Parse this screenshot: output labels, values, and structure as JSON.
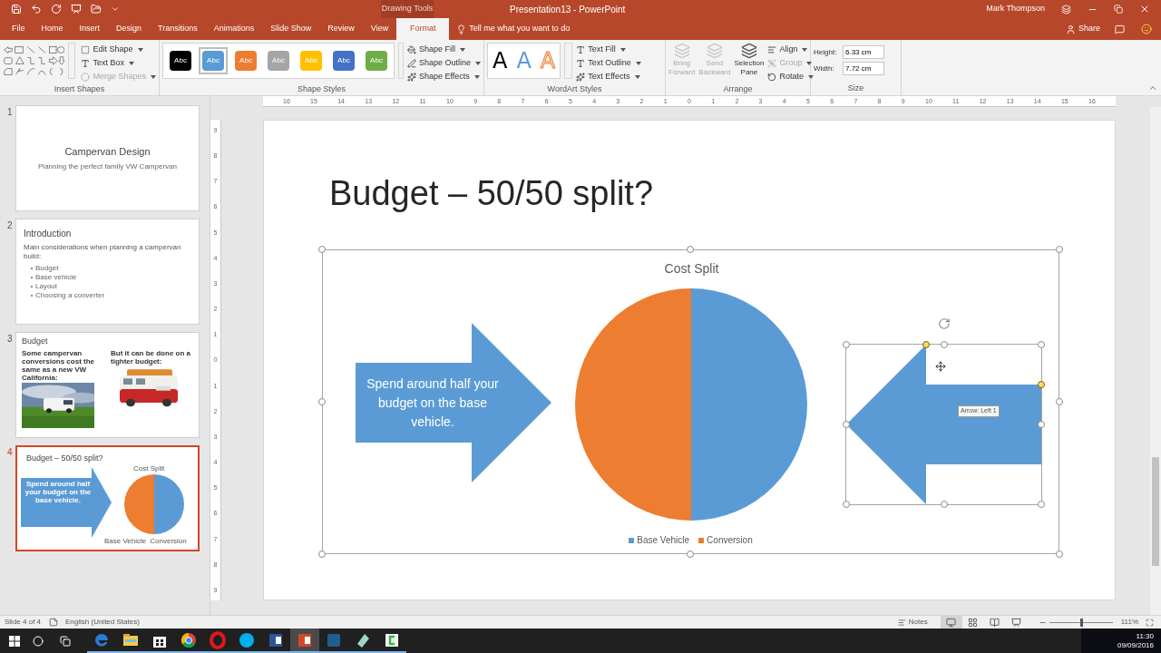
{
  "window": {
    "title": "Presentation13 - PowerPoint",
    "user": "Mark Thompson",
    "context_label": "Drawing Tools"
  },
  "tabs": [
    {
      "label": "File",
      "selected": false
    },
    {
      "label": "Home",
      "selected": false
    },
    {
      "label": "Insert",
      "selected": false
    },
    {
      "label": "Design",
      "selected": false
    },
    {
      "label": "Transitions",
      "selected": false
    },
    {
      "label": "Animations",
      "selected": false
    },
    {
      "label": "Slide Show",
      "selected": false
    },
    {
      "label": "Review",
      "selected": false
    },
    {
      "label": "View",
      "selected": false
    },
    {
      "label": "Format",
      "selected": true
    }
  ],
  "tell_me": "Tell me what you want to do",
  "share": "Share",
  "ribbon": {
    "insert_shapes": {
      "label": "Insert Shapes",
      "buttons": [
        {
          "label": "Edit Shape",
          "disabled": false
        },
        {
          "label": "Text Box",
          "disabled": false
        },
        {
          "label": "Merge Shapes",
          "disabled": true
        }
      ]
    },
    "shape_styles": {
      "label": "Shape Styles",
      "swatches": [
        {
          "label": "Abc",
          "color": "#000000",
          "selected": false
        },
        {
          "label": "Abc",
          "color": "#5b9bd5",
          "selected": true
        },
        {
          "label": "Abc",
          "color": "#ed7d31",
          "selected": false
        },
        {
          "label": "Abc",
          "color": "#a5a5a5",
          "selected": false
        },
        {
          "label": "Abc",
          "color": "#ffc000",
          "selected": false
        },
        {
          "label": "Abc",
          "color": "#4472c4",
          "selected": false
        },
        {
          "label": "Abc",
          "color": "#70ad47",
          "selected": false
        }
      ],
      "buttons": [
        {
          "label": "Shape Fill"
        },
        {
          "label": "Shape Outline"
        },
        {
          "label": "Shape Effects"
        }
      ]
    },
    "wordart_styles": {
      "label": "WordArt Styles",
      "samples": [
        {
          "label": "A",
          "kind": "solid"
        },
        {
          "label": "A",
          "kind": "light"
        },
        {
          "label": "A",
          "kind": "outline"
        }
      ],
      "buttons": [
        {
          "label": "Text Fill"
        },
        {
          "label": "Text Outline"
        },
        {
          "label": "Text Effects"
        }
      ]
    },
    "arrange": {
      "label": "Arrange",
      "large_buttons": [
        {
          "label": "Bring Forward",
          "disabled": true
        },
        {
          "label": "Send Backward",
          "disabled": true
        },
        {
          "label": "Selection Pane",
          "disabled": false
        }
      ],
      "small_buttons": [
        {
          "label": "Align",
          "disabled": false
        },
        {
          "label": "Group",
          "disabled": true
        },
        {
          "label": "Rotate",
          "disabled": false
        }
      ]
    },
    "size": {
      "label": "Size",
      "fields": [
        {
          "label": "Height:",
          "value": "6.33 cm"
        },
        {
          "label": "Width:",
          "value": "7.72 cm"
        }
      ]
    }
  },
  "rulers": {
    "horizontal": [
      "16",
      "15",
      "14",
      "13",
      "12",
      "11",
      "10",
      "9",
      "8",
      "7",
      "6",
      "5",
      "4",
      "3",
      "2",
      "1",
      "0",
      "1",
      "2",
      "3",
      "4",
      "5",
      "6",
      "7",
      "8",
      "9",
      "10",
      "11",
      "12",
      "13",
      "14",
      "15",
      "16"
    ],
    "vertical": [
      "9",
      "8",
      "7",
      "6",
      "5",
      "4",
      "3",
      "2",
      "1",
      "0",
      "1",
      "2",
      "3",
      "4",
      "5",
      "6",
      "7",
      "8",
      "9"
    ]
  },
  "slides": [
    {
      "number": "1",
      "selected": false,
      "kind": "title",
      "title": "Campervan Design",
      "subtitle": "Planning the perfect family VW Campervan"
    },
    {
      "number": "2",
      "selected": false,
      "kind": "bullets",
      "title": "Introduction",
      "text": "Main considerations when planning a campervan build:",
      "bullets": [
        "Budget",
        "Base vehicle",
        "Layout",
        "Choosing a converter"
      ]
    },
    {
      "number": "3",
      "selected": false,
      "kind": "photos",
      "title": "Budget",
      "captions": [
        "Some campervan conversions cost the same as a new VW California:",
        "But it can be done on a tighter budget:"
      ]
    },
    {
      "number": "4",
      "selected": true,
      "kind": "chart",
      "title": "Budget – 50/50 split?",
      "arrow_text": "Spend around half your budget on the base vehicle.",
      "chart_title": "Cost Split",
      "legend": [
        "Base Vehicle",
        "Conversion"
      ]
    }
  ],
  "slide": {
    "title": "Budget – 50/50 split?",
    "right_arrow": {
      "text": "Spend around half your budget on the base vehicle."
    },
    "chart": {
      "selected": true,
      "chart_data": {
        "type": "pie",
        "title": "Cost Split",
        "categories": [
          "Base Vehicle",
          "Conversion"
        ],
        "colors": [
          "#5b9bd5",
          "#ed7d31"
        ],
        "values": [
          50,
          50
        ]
      }
    },
    "left_arrow": {
      "selected": true,
      "tooltip": "Arrow: Left 1"
    }
  },
  "status": {
    "slide_info": "Slide 4 of 4",
    "language": "English (United States)",
    "notes": "Notes",
    "views": [
      {
        "kind": "normal",
        "selected": true
      },
      {
        "kind": "sorter",
        "selected": false
      },
      {
        "kind": "reading",
        "selected": false
      },
      {
        "kind": "slideshow",
        "selected": false
      }
    ],
    "zoom_slider": {
      "level": 0.5
    },
    "zoom": "111%"
  },
  "taskbar": {
    "apps": [
      {
        "kind": "edge",
        "selected": false
      },
      {
        "kind": "explorer",
        "selected": false
      },
      {
        "kind": "store",
        "selected": false
      },
      {
        "kind": "chrome",
        "selected": false
      },
      {
        "kind": "opera",
        "selected": false
      },
      {
        "kind": "skype",
        "selected": false
      },
      {
        "kind": "word",
        "selected": false
      },
      {
        "kind": "powerpoint",
        "selected": true
      },
      {
        "kind": "snagit",
        "selected": false
      },
      {
        "kind": "notepad",
        "selected": false
      },
      {
        "kind": "camtasia",
        "selected": false
      }
    ],
    "time": "11:30",
    "date": "09/09/2016"
  }
}
